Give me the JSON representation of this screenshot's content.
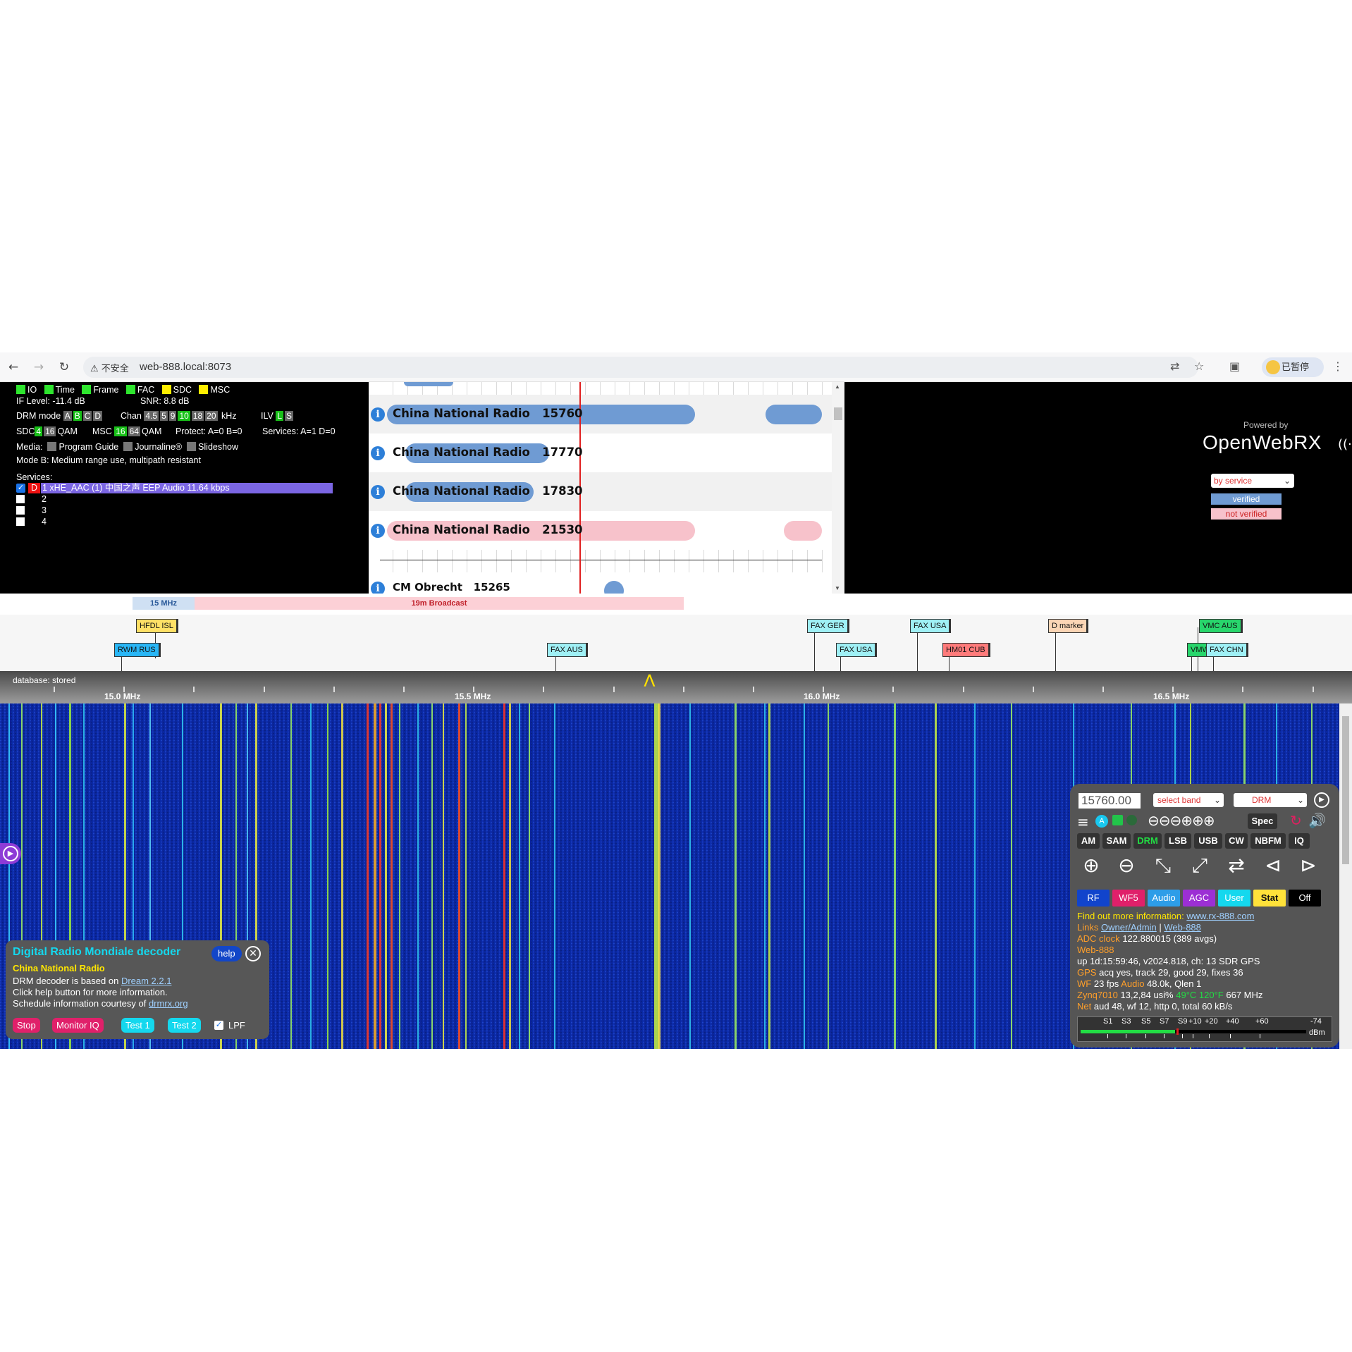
{
  "browser": {
    "insecure_label": "不安全",
    "url": "web-888.local:8073",
    "profile_label": "已暂停"
  },
  "drm_status": {
    "indicators": [
      "IO",
      "Time",
      "Frame",
      "FAC",
      "SDC",
      "MSC"
    ],
    "if_level": "IF Level: -11.4 dB",
    "snr": "SNR: 8.8 dB",
    "drm_mode_label": "DRM mode",
    "drm_modes": [
      "A",
      "B",
      "C",
      "D"
    ],
    "chan_label": "Chan",
    "chan_values": [
      "4.5",
      "5",
      "9",
      "10",
      "18",
      "20"
    ],
    "chan_unit": "kHz",
    "ilv_label": "ILV",
    "ilv_values": [
      "L",
      "S"
    ],
    "sdc_label": "SDC",
    "sdc_values": [
      "4",
      "16"
    ],
    "sdc_unit": "QAM",
    "msc_label": "MSC",
    "msc_values": [
      "16",
      "64"
    ],
    "msc_unit": "QAM",
    "protect": "Protect: A=0 B=0",
    "services_count": "Services: A=1 D=0",
    "media_label": "Media:",
    "media_items": [
      "Program Guide",
      "Journaline®",
      "Slideshow"
    ],
    "mode_desc": "Mode B: Medium range use, multipath resistant",
    "services_label": "Services:",
    "service_1_tag": "D",
    "service_1": "1 xHE_AAC (1) 中国之声 EEP Audio 11.64 kbps",
    "service_2": "2",
    "service_3": "3",
    "service_4": "4"
  },
  "schedule": {
    "rows": [
      {
        "name": "China National Radio",
        "freq": "15760",
        "status": "verified"
      },
      {
        "name": "China National Radio",
        "freq": "17770",
        "status": "verified"
      },
      {
        "name": "China National Radio",
        "freq": "17830",
        "status": "verified"
      },
      {
        "name": "China National Radio",
        "freq": "21530",
        "status": "not verified"
      }
    ],
    "partial_row": {
      "name": "CM Obrecht",
      "freq": "15265"
    }
  },
  "branding": {
    "powered_by": "Powered by",
    "logo": "OpenWebRX"
  },
  "legend": {
    "select": "by service",
    "verified": "verified",
    "not_verified": "not verified"
  },
  "bands": {
    "left": "15 MHz",
    "main": "19m Broadcast"
  },
  "markers": [
    "HFDL ISL",
    "RWM RUS",
    "FAX AUS",
    "FAX GER",
    "FAX USA",
    "FAX USA",
    "HM01 CUB",
    "D marker",
    "VMC AUS",
    "VMW",
    "FAX CHN"
  ],
  "scale": {
    "database": "database: stored",
    "labels": [
      "15.0 MHz",
      "15.5 MHz",
      "16.0 MHz",
      "16.5 MHz"
    ]
  },
  "control": {
    "frequency": "15760.00",
    "band_select": "select band",
    "mode_select": "DRM",
    "spec_label": "Spec",
    "modes": [
      "AM",
      "SAM",
      "DRM",
      "LSB",
      "USB",
      "CW",
      "NBFM",
      "IQ"
    ],
    "panels": [
      "RF",
      "WF5",
      "Audio",
      "AGC",
      "User",
      "Stat",
      "Off"
    ],
    "info_line": "Find out more information:",
    "info_link": "www.rx-888.com",
    "links_label": "Links",
    "link_owner": "Owner/Admin",
    "link_sep": "|",
    "link_web": "Web-888",
    "adc_label": "ADC clock",
    "adc_value": "122.880015 (389 avgs)",
    "device": "Web-888",
    "uptime": "up 1d:15:59:46, v2024.818, ch: 13 SDR GPS",
    "gps_label": "GPS",
    "gps_value": "acq yes, track 29, good 29, fixes 36",
    "wf_label": "WF",
    "wf_value": "23 fps",
    "audio_label": "Audio",
    "audio_value": "48.0k, Qlen 1",
    "zynq_label": "Zynq7010",
    "zynq_value": "13,2,84 usi%",
    "temp_value": "49°C 120°F",
    "mhz_value": "667 MHz",
    "net_label": "Net",
    "net_value": "aud 48, wf 12, http 0, total 60 kB/s",
    "smeter_labels": [
      "S1",
      "S3",
      "S5",
      "S7",
      "S9",
      "+10",
      "+20",
      "+40",
      "+60"
    ],
    "smeter_dbm": "-74",
    "smeter_unit": "dBm",
    "smeter_level": 0.42
  },
  "drm_decoder": {
    "title": "Digital Radio Mondiale decoder",
    "help": "help",
    "station": "China National Radio",
    "line1_prefix": "DRM decoder is based on",
    "line1_link": "Dream 2.2.1",
    "line2": "Click help button for more information.",
    "line3_prefix": "Schedule information courtesy of",
    "line3_link": "drmrx.org",
    "buttons": [
      "Stop",
      "Monitor IQ",
      "Test 1",
      "Test 2"
    ],
    "lpf_label": "LPF"
  },
  "colors": {
    "verified": "#6f9bd3",
    "not_verified": "#f7c2cb",
    "service_highlight": "#7b66e3",
    "waterfall_bg": "#0a2aa8"
  }
}
